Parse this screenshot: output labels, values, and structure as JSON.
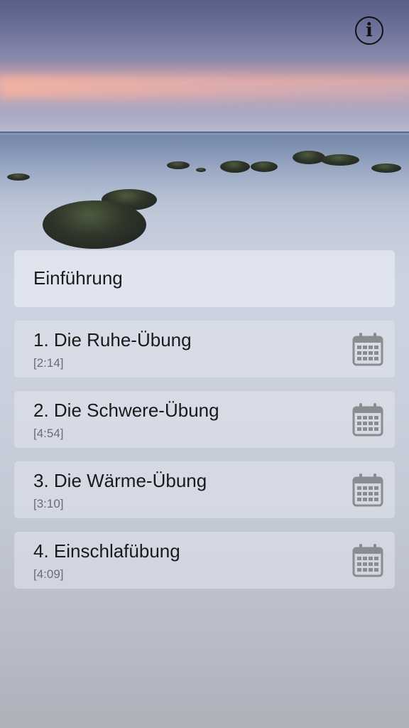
{
  "header": {
    "info_button": {
      "icon": "info-icon",
      "label": "i"
    }
  },
  "intro": {
    "label": "Einführung"
  },
  "exercises": [
    {
      "title": "1. Die Ruhe-Übung",
      "duration": "[2:14]",
      "icon": "calendar-icon"
    },
    {
      "title": "2. Die Schwere-Übung",
      "duration": "[4:54]",
      "icon": "calendar-icon"
    },
    {
      "title": "3. Die Wärme-Übung",
      "duration": "[3:10]",
      "icon": "calendar-icon"
    },
    {
      "title": "4. Einschlafübung",
      "duration": "[4:09]",
      "icon": "calendar-icon"
    }
  ],
  "colors": {
    "icon": "#8a8c90",
    "text": "#1a1a1a",
    "duration": "#6a6d74"
  }
}
